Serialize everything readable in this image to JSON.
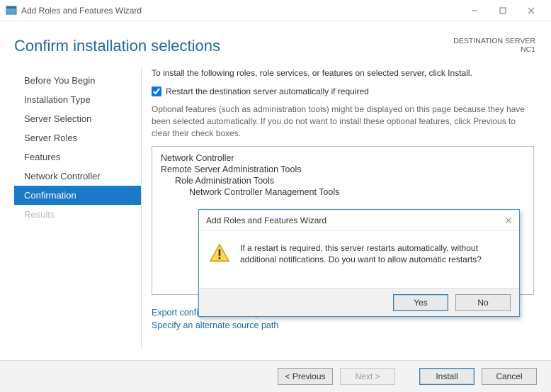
{
  "window": {
    "title": "Add Roles and Features Wizard"
  },
  "page": {
    "heading": "Confirm installation selections",
    "destination_label": "DESTINATION SERVER",
    "destination_server": "NC1",
    "intro": "To install the following roles, role services, or features on selected server, click Install.",
    "checkbox_label": "Restart the destination server automatically if required",
    "checkbox_checked": "true",
    "optional_note": "Optional features (such as administration tools) might be displayed on this page because they have been selected automatically. If you do not want to install these optional features, click Previous to clear their check boxes.",
    "link_export": "Export configuration settings",
    "link_path": "Specify an alternate source path"
  },
  "sidebar": {
    "items": [
      {
        "label": "Before You Begin",
        "state": "normal"
      },
      {
        "label": "Installation Type",
        "state": "normal"
      },
      {
        "label": "Server Selection",
        "state": "normal"
      },
      {
        "label": "Server Roles",
        "state": "normal"
      },
      {
        "label": "Features",
        "state": "normal"
      },
      {
        "label": "Network Controller",
        "state": "normal"
      },
      {
        "label": "Confirmation",
        "state": "selected"
      },
      {
        "label": "Results",
        "state": "disabled"
      }
    ]
  },
  "selections": [
    {
      "label": "Network Controller",
      "indent": 1
    },
    {
      "label": "Remote Server Administration Tools",
      "indent": 1
    },
    {
      "label": "Role Administration Tools",
      "indent": 2
    },
    {
      "label": "Network Controller Management Tools",
      "indent": 3
    }
  ],
  "footer": {
    "previous": "< Previous",
    "next": "Next >",
    "install": "Install",
    "cancel": "Cancel"
  },
  "dialog": {
    "title": "Add Roles and Features Wizard",
    "message": "If a restart is required, this server restarts automatically, without additional notifications. Do you want to allow automatic restarts?",
    "yes": "Yes",
    "no": "No"
  }
}
